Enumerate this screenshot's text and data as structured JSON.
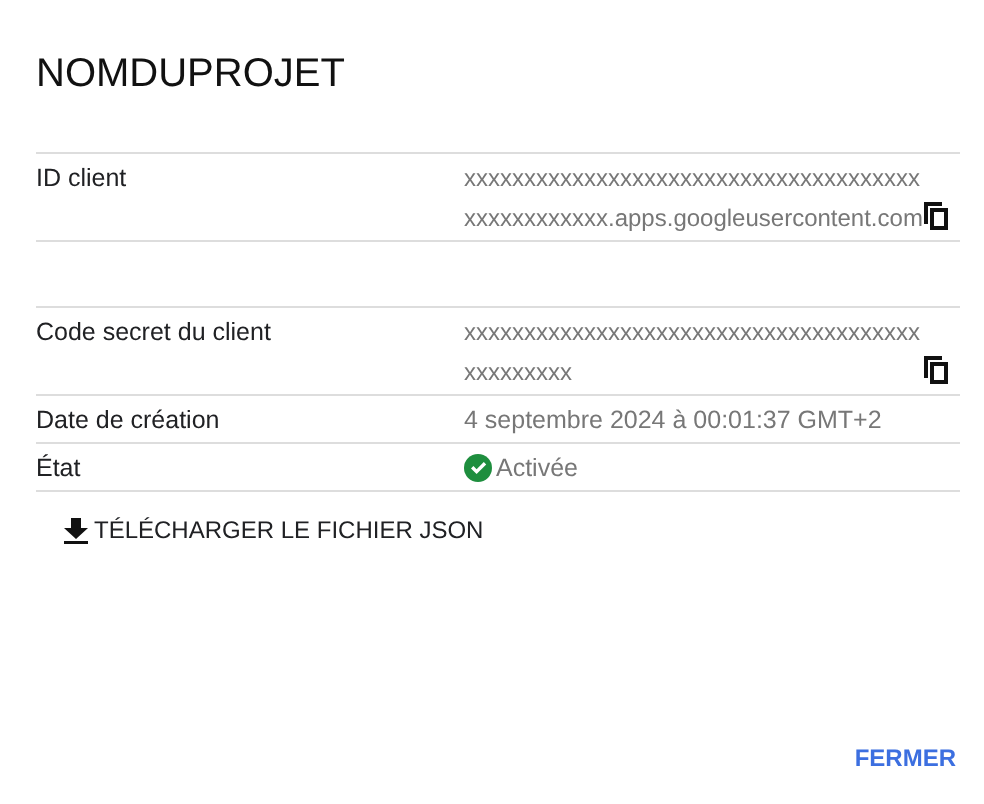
{
  "title": "NOMDUPROJET",
  "groups": [
    {
      "rows": [
        {
          "kind": "secret",
          "label": "ID client",
          "value": "xxxxxxxxxxxxxxxxxxxxxxxxxxxxxxxxxxxxxxxxxxxxxxxxxx.apps.googleusercontent.com"
        }
      ]
    },
    {
      "rows": [
        {
          "kind": "secret",
          "label": "Code secret du client",
          "value": "xxxxxxxxxxxxxxxxxxxxxxxxxxxxxxxxxxxxxxxxxxxxxxx"
        },
        {
          "kind": "text",
          "label": "Date de création",
          "value": "4 septembre 2024 à 00:01:37 GMT+2"
        },
        {
          "kind": "status",
          "label": "État",
          "value": "Activée"
        }
      ]
    }
  ],
  "download_button": "TÉLÉCHARGER LE FICHIER JSON",
  "close_button": "FERMER"
}
